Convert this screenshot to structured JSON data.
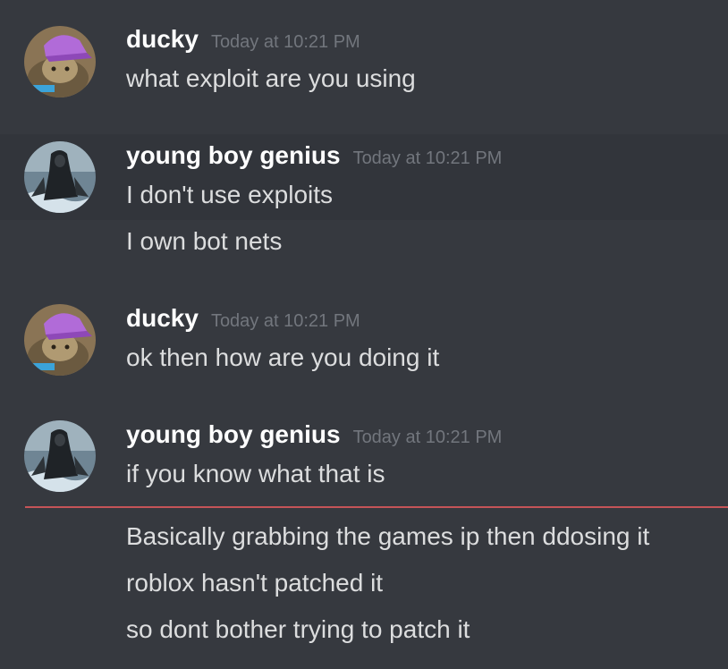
{
  "messages": [
    {
      "username": "ducky",
      "timestamp": "Today at 10:21 PM",
      "avatar": "purple-hat-avatar",
      "lines": [
        "what exploit are you using"
      ]
    },
    {
      "username": "young boy genius",
      "timestamp": "Today at 10:21 PM",
      "avatar": "hooded-figure-avatar",
      "lines": [
        "I don't use exploits",
        "I own bot nets"
      ]
    },
    {
      "username": "ducky",
      "timestamp": "Today at 10:21 PM",
      "avatar": "purple-hat-avatar",
      "lines": [
        "ok then how are you doing it"
      ]
    },
    {
      "username": "young boy genius",
      "timestamp": "Today at 10:21 PM",
      "avatar": "hooded-figure-avatar",
      "lines": [
        "if you know what that is"
      ]
    }
  ],
  "after_new_messages": {
    "lines": [
      "Basically grabbing the games ip then ddosing it",
      "roblox hasn't patched it",
      "so dont bother trying to patch it"
    ]
  },
  "colors": {
    "background": "#36393f",
    "username": "#ffffff",
    "timestamp": "#72767d",
    "message_text": "#dcddde",
    "new_messages_divider": "#c55458"
  }
}
